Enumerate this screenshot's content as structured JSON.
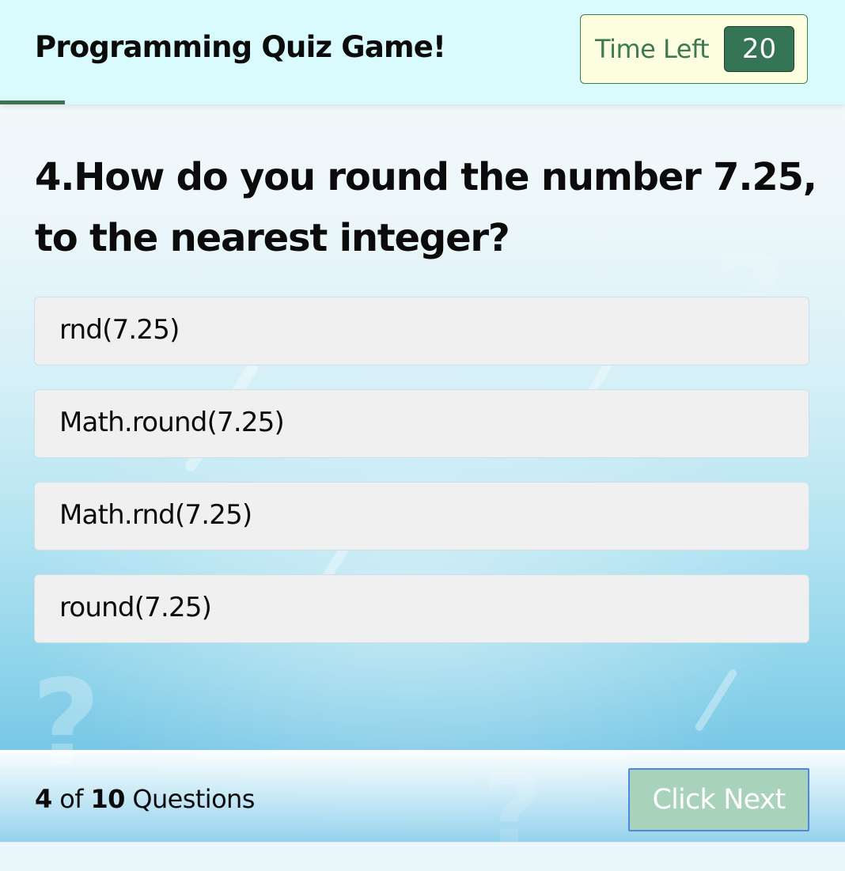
{
  "header": {
    "title": "Programming Quiz Game!",
    "progress_fraction": 0.077
  },
  "timer": {
    "label": "Time Left",
    "count": "20"
  },
  "question": {
    "number": "4",
    "text": "4.How do you round the number 7.25, to the nearest integer?"
  },
  "options": [
    {
      "label": "rnd(7.25)"
    },
    {
      "label": "Math.round(7.25)"
    },
    {
      "label": "Math.rnd(7.25)"
    },
    {
      "label": "round(7.25)"
    }
  ],
  "footer": {
    "current": "4",
    "of_text": "of",
    "total": "10",
    "questions_text": "Questions",
    "next_label": "Click Next"
  },
  "colors": {
    "header_bg": "#d9fbfd",
    "accent_green": "#357455",
    "timer_bg": "#fdfde0",
    "option_bg": "#f0f0f0",
    "next_button_bg": "#a9d2bb",
    "next_button_border": "#4f86e3"
  }
}
